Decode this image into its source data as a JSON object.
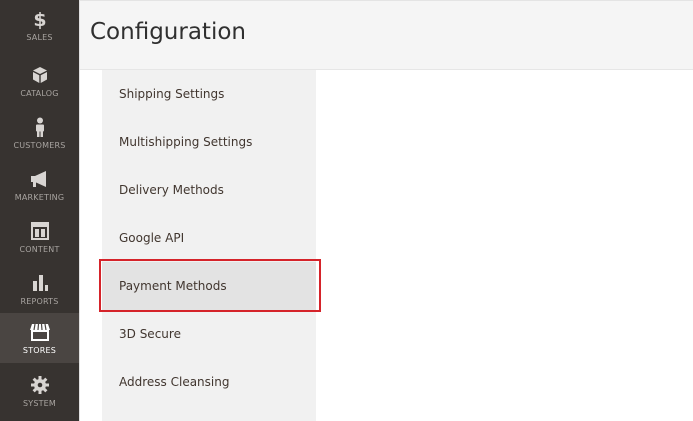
{
  "sidebar": {
    "items": [
      {
        "key": "sales",
        "label": "SALES",
        "icon": "dollar-icon"
      },
      {
        "key": "catalog",
        "label": "CATALOG",
        "icon": "box-icon"
      },
      {
        "key": "customers",
        "label": "CUSTOMERS",
        "icon": "person-icon"
      },
      {
        "key": "marketing",
        "label": "MARKETING",
        "icon": "megaphone-icon"
      },
      {
        "key": "content",
        "label": "CONTENT",
        "icon": "layout-icon"
      },
      {
        "key": "reports",
        "label": "REPORTS",
        "icon": "bar-chart-icon"
      },
      {
        "key": "stores",
        "label": "STORES",
        "icon": "storefront-icon",
        "active": true
      },
      {
        "key": "system",
        "label": "SYSTEM",
        "icon": "gear-icon"
      }
    ]
  },
  "header": {
    "title": "Configuration"
  },
  "submenu": {
    "items": [
      {
        "label": "Shipping Settings"
      },
      {
        "label": "Multishipping Settings"
      },
      {
        "label": "Delivery Methods"
      },
      {
        "label": "Google API"
      },
      {
        "label": "Payment Methods",
        "selected": true,
        "highlighted": true
      },
      {
        "label": "3D Secure"
      },
      {
        "label": "Address Cleansing"
      }
    ]
  },
  "colors": {
    "sidebar_bg": "#373330",
    "highlight_border": "#d5232a",
    "submenu_bg": "#f1f1f1"
  }
}
